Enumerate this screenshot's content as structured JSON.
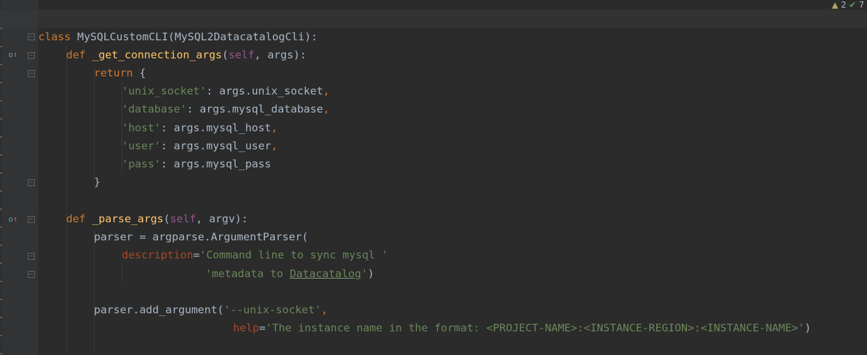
{
  "status": {
    "warnings": "2",
    "weak_warnings": "7",
    "warn_icon": "warning-triangle-icon",
    "check_icon": "double-check-icon"
  },
  "lines": {
    "l1": {
      "kw": "class",
      "name": " MySQLCustomCLI(MySQL2DatacatalogCli):"
    },
    "l2": {
      "kw": "def",
      "fn": "_get_connection_args",
      "open": "(",
      "self": "self",
      "rest": ", args):"
    },
    "l3": {
      "kw": "return",
      "rest": " {"
    },
    "l4": {
      "key": "'unix_socket'",
      "val": ": args.unix_socket",
      "comma": ","
    },
    "l5": {
      "key": "'database'",
      "val": ": args.mysql_database",
      "comma": ","
    },
    "l6": {
      "key": "'host'",
      "val": ": args.mysql_host",
      "comma": ","
    },
    "l7": {
      "key": "'user'",
      "val": ": args.mysql_user",
      "comma": ","
    },
    "l8": {
      "key": "'pass'",
      "val": ": args.mysql_pass"
    },
    "l9": {
      "text": "}"
    },
    "l10": {
      "kw": "def",
      "fn": "_parse_args",
      "open": "(",
      "self": "self",
      "rest": ", argv):"
    },
    "l11": {
      "text": "parser = argparse.ArgumentParser("
    },
    "l12": {
      "param": "description",
      "eq": "=",
      "str": "'Command line to sync mysql '"
    },
    "l13": {
      "str1": "'metadata to ",
      "ul": "Datacatalog",
      "str2": "'",
      "close": ")"
    },
    "l14": {
      "text": "parser.add_argument(",
      "str": "'--unix-socket'",
      "comma": ","
    },
    "l15": {
      "param": "help",
      "eq": "=",
      "str": "'The instance name in the format: <PROJECT-NAME>:<INSTANCE-REGION>:<INSTANCE-NAME>'",
      "close": ")"
    }
  },
  "gutter_icons": {
    "override": "override-method-icon",
    "fold": "fold-icon"
  }
}
